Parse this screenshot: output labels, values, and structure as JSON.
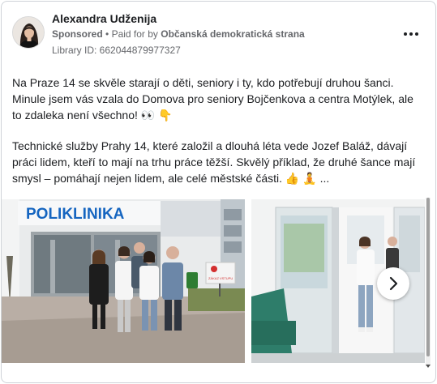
{
  "post": {
    "author_name": "Alexandra Udženija",
    "sponsored_label": "Sponsored",
    "paid_for_prefix": "Paid for by",
    "sponsor_name": "Občanská demokratická strana",
    "library_id": "Library ID: 662044879977327",
    "paragraph1": "Na Praze 14 se skvěle starají o děti, seniory i ty, kdo potřebují druhou šanci. Minule jsem vás vzala do Domova pro seniory Bojčenkova a centra Motýlek, ale to zdaleka není všechno! 👀 👇",
    "paragraph2": "Technické služby Prahy 14, které založil a dlouhá léta vede Jozef Baláž, dávají práci lidem, kteří to mají na trhu práce těžší. Skvělý příklad, že druhé šance mají smysl – pomáhají nejen lidem, ale celé městské části. 👍 🧘",
    "more_label": "...",
    "more_icon": "three-dots-icon"
  },
  "carousel": {
    "slide1": {
      "sign_text": "POLIKLINIKA",
      "notice_label": "ZÁKAZ VSTUPU"
    },
    "next_icon": "chevron-right-icon"
  },
  "colors": {
    "text": "#1c1e21",
    "secondary": "#65676b",
    "sign_blue": "#1565c0"
  }
}
